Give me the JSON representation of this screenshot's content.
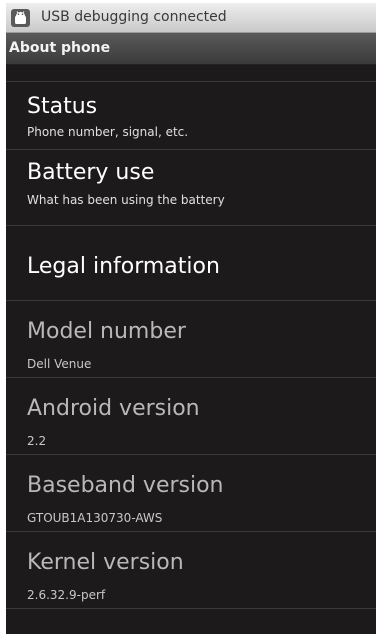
{
  "status_bar": {
    "notification_icon": "android-debug-icon",
    "text": "USB debugging connected"
  },
  "header": {
    "title": "About phone"
  },
  "settings_list": {
    "items": [
      {
        "title": "Status",
        "subtitle": "Phone number, signal, etc.",
        "enabled": true
      },
      {
        "title": "Battery use",
        "subtitle": "What has been using the battery",
        "enabled": true
      },
      {
        "title": "Legal information",
        "enabled": true
      },
      {
        "title": "Model number",
        "subtitle": "Dell Venue",
        "enabled": false
      },
      {
        "title": "Android version",
        "subtitle": "2.2",
        "enabled": false
      },
      {
        "title": "Baseband version",
        "subtitle": "GTOUB1A130730-AWS",
        "enabled": false
      },
      {
        "title": "Kernel version",
        "subtitle": "2.6.32.9-perf",
        "enabled": false
      }
    ]
  },
  "colors": {
    "background": "#1c1a1b",
    "status_bar": "#dcdcdc",
    "title_bar": "#4a4a4a",
    "enabled_text": "#ffffff",
    "disabled_text": "#b8b8b8"
  }
}
